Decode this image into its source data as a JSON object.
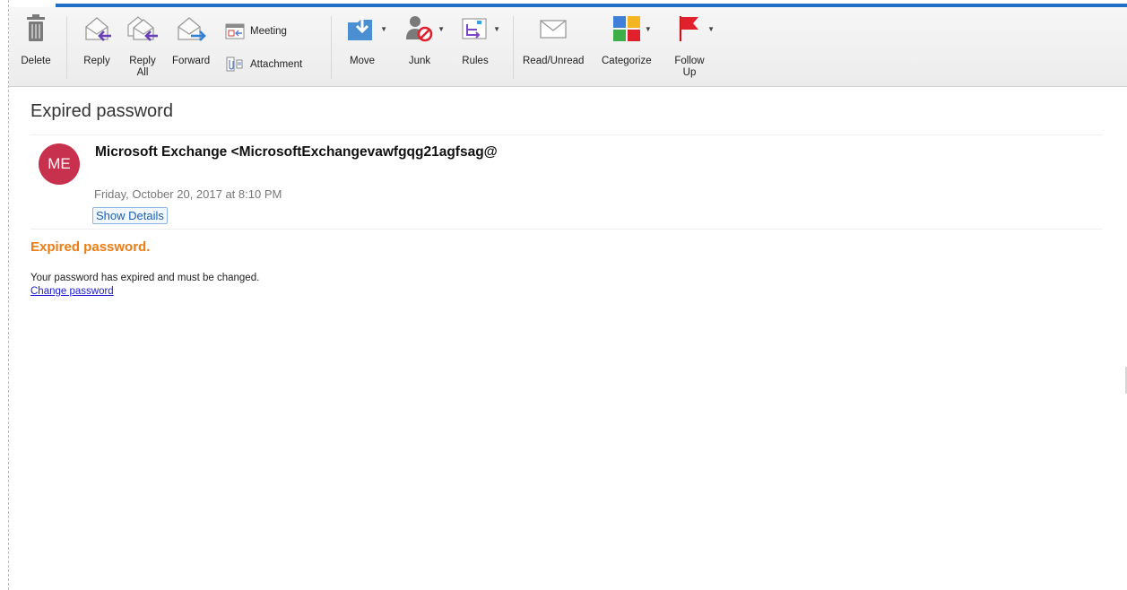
{
  "toolbar": {
    "delete": "Delete",
    "reply": "Reply",
    "reply_all_1": "Reply",
    "reply_all_2": "All",
    "forward": "Forward",
    "meeting": "Meeting",
    "attachment": "Attachment",
    "move": "Move",
    "junk": "Junk",
    "rules": "Rules",
    "read_unread": "Read/Unread",
    "categorize": "Categorize",
    "follow_up_1": "Follow",
    "follow_up_2": "Up"
  },
  "icons": {
    "delete": "trash-icon",
    "reply": "reply-icon",
    "reply_all": "reply-all-icon",
    "forward": "forward-icon",
    "meeting": "calendar-icon",
    "attachment": "paperclip-icon",
    "move": "folder-move-icon",
    "junk": "junk-icon",
    "rules": "rules-icon",
    "read_unread": "envelope-icon",
    "categorize": "color-grid-icon",
    "follow_up": "flag-icon"
  },
  "colors": {
    "accent": "#1f6fc5",
    "avatar": "#c8314d",
    "alert": "#f07b12",
    "link": "#1a1ad6",
    "flag": "#e0202a"
  },
  "message": {
    "subject": "Expired password",
    "avatar_initials": "ME",
    "sender": "Microsoft Exchange <MicrosoftExchangevawfgqg21agfsag@",
    "date": "Friday, October 20, 2017 at 8:10 PM",
    "show_details": "Show Details",
    "body_title": "Expired password.",
    "body_text": "Your password has expired and must be changed.",
    "body_link": "Change password"
  }
}
